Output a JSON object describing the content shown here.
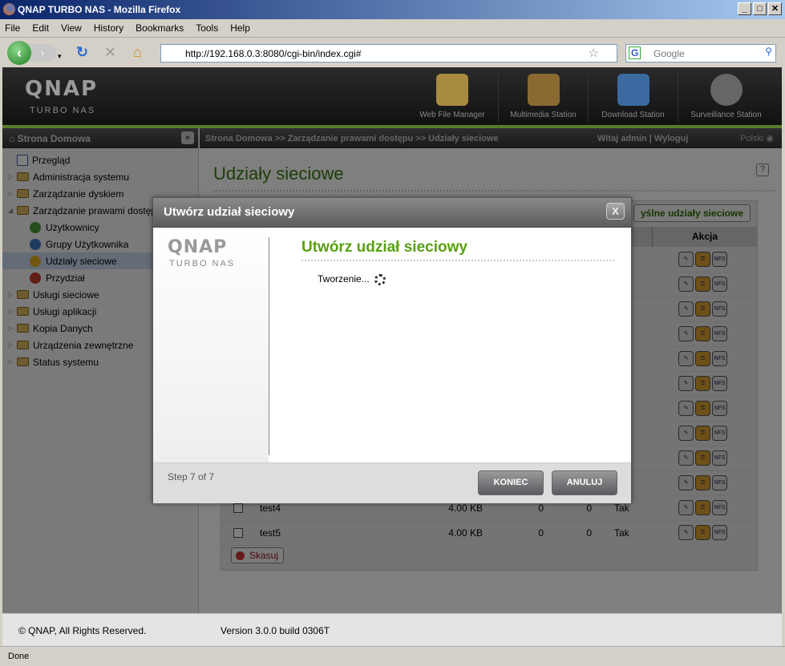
{
  "browser": {
    "title": "QNAP TURBO NAS - Mozilla Firefox",
    "menu": [
      "File",
      "Edit",
      "View",
      "History",
      "Bookmarks",
      "Tools",
      "Help"
    ],
    "url": "http://192.168.0.3:8080/cgi-bin/index.cgi#",
    "search_placeholder": "Google",
    "status": "Done"
  },
  "header": {
    "logo": "QNAP",
    "subtitle": "TURBO NAS",
    "apps": [
      "Web File Manager",
      "Multimedia Station",
      "Download Station",
      "Surveillance Station"
    ]
  },
  "sidebar": {
    "title": "Strona Domowa",
    "items": [
      {
        "label": "Przegląd",
        "level": 0,
        "icon": "overview-icon"
      },
      {
        "label": "Administracja systemu",
        "level": 0,
        "icon": "folder-icon"
      },
      {
        "label": "Zarządzanie dyskiem",
        "level": 0,
        "icon": "folder-icon"
      },
      {
        "label": "Zarządzanie prawami dostępu",
        "level": 0,
        "icon": "folder-open-icon",
        "expanded": true
      },
      {
        "label": "Użytkownicy",
        "level": 1,
        "icon": "user-icon"
      },
      {
        "label": "Grupy Użytkownika",
        "level": 1,
        "icon": "group-icon"
      },
      {
        "label": "Udziały sieciowe",
        "level": 1,
        "icon": "share-icon",
        "selected": true
      },
      {
        "label": "Przydział",
        "level": 1,
        "icon": "quota-icon"
      },
      {
        "label": "Usługi sieciowe",
        "level": 0,
        "icon": "folder-icon"
      },
      {
        "label": "Usługi aplikacji",
        "level": 0,
        "icon": "folder-icon"
      },
      {
        "label": "Kopia Danych",
        "level": 0,
        "icon": "folder-icon"
      },
      {
        "label": "Urządzenia zewnętrzne",
        "level": 0,
        "icon": "folder-icon"
      },
      {
        "label": "Status systemu",
        "level": 0,
        "icon": "folder-icon"
      }
    ]
  },
  "breadcrumb": "Strona Domowa >> Zarządzanie prawami dostępu >> Udziały sieciowe",
  "welcome": "Witaj admin | Wyloguj",
  "language": "Polski",
  "main": {
    "title": "Udziały sieciowe",
    "default_shares_button": "Domyślne udziały sieciowe",
    "visible_default_button": "yślne udziały sieciowe",
    "akcja_header": "Akcja",
    "delete_button": "Skasuj",
    "rows": [
      {
        "name": "test4",
        "size": "4.00 KB",
        "c1": "0",
        "c2": "0",
        "c3": "Tak"
      },
      {
        "name": "test5",
        "size": "4.00 KB",
        "c1": "0",
        "c2": "0",
        "c3": "Tak"
      }
    ],
    "action_icons": [
      "edit-icon",
      "permission-icon",
      "nfs-icon"
    ],
    "nfs_label": "NFS"
  },
  "footer": {
    "copyright": "© QNAP, All Rights Reserved.",
    "version": "Version 3.0.0 build 0306T"
  },
  "modal": {
    "title": "Utwórz udział sieciowy",
    "heading": "Utwórz udział sieciowy",
    "message": "Tworzenie...",
    "step": "Step 7 of 7",
    "finish": "KONIEC",
    "cancel": "ANULUJ",
    "logo": "QNAP",
    "logo_sub": "TURBO NAS"
  }
}
